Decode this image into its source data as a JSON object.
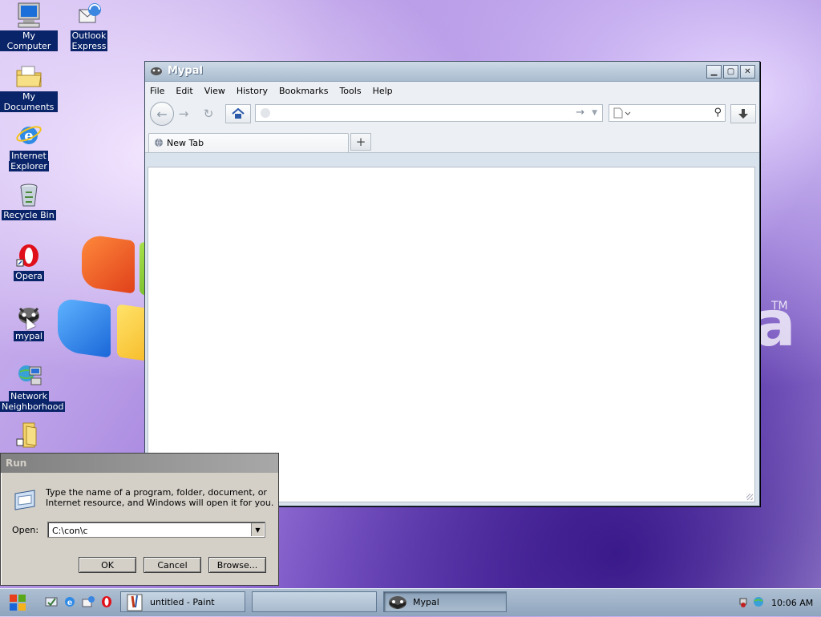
{
  "desktop": {
    "icons": [
      {
        "label_lines": [
          "My Computer"
        ],
        "icon": "my-computer-icon"
      },
      {
        "label_lines": [
          "Outlook",
          "Express"
        ],
        "icon": "outlook-express-icon"
      },
      {
        "label_lines": [
          "My Documents"
        ],
        "icon": "my-documents-icon"
      },
      {
        "label_lines": [
          "Internet",
          "Explorer"
        ],
        "icon": "internet-explorer-icon"
      },
      {
        "label_lines": [
          "Recycle Bin"
        ],
        "icon": "recycle-bin-icon"
      },
      {
        "label_lines": [
          "Opera"
        ],
        "icon": "opera-icon"
      },
      {
        "label_lines": [
          "mypal"
        ],
        "icon": "mypal-icon"
      },
      {
        "label_lines": [
          "Network",
          "Neighborhood"
        ],
        "icon": "network-neighborhood-icon"
      }
    ],
    "wallpaper_mark": "a",
    "wallpaper_tm": "TM"
  },
  "browser": {
    "title": "Mypal",
    "menu": [
      "File",
      "Edit",
      "View",
      "History",
      "Bookmarks",
      "Tools",
      "Help"
    ],
    "url_value": "",
    "search_value": "",
    "tabs": [
      {
        "label": "New Tab",
        "active": true
      }
    ],
    "new_tab_label": "+"
  },
  "run_dialog": {
    "title": "Run",
    "description_line1": "Type the name of a program, folder, document, or",
    "description_line2": "Internet resource, and Windows will open it for you.",
    "open_label": "Open:",
    "open_value": "C:\\con\\c",
    "ok_label": "OK",
    "cancel_label": "Cancel",
    "browse_label": "Browse..."
  },
  "taskbar": {
    "buttons": [
      {
        "label": "untitled - Paint",
        "active": false
      },
      {
        "label": "",
        "active": false
      },
      {
        "label": "Mypal",
        "active": true
      }
    ],
    "clock": "10:06 AM"
  },
  "colors": {
    "selection": "#0a246a",
    "titlebar_start": "#cdd9e6",
    "titlebar_end": "#a9bccf",
    "dialog_face": "#d4d0c8",
    "taskbar": "#8fa5bd"
  }
}
